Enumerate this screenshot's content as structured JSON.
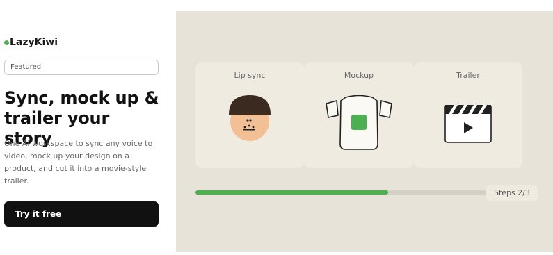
{
  "brand": {
    "name": "LazyKiwi",
    "dot_color": "#4caf50"
  },
  "hero": {
    "badge": "Featured",
    "headline": "Sync, mock up & trailer your story",
    "description": "One AI workspace to sync any voice to video, mock up your design on a product, and cut it into a movie-style trailer.",
    "cta_label": "Try it free"
  },
  "demo": {
    "cards": [
      {
        "label": "Lip sync",
        "icon": "face-icon"
      },
      {
        "label": "Mockup",
        "icon": "tshirt-icon"
      },
      {
        "label": "Trailer",
        "icon": "clapperboard-icon"
      }
    ],
    "progress": {
      "value": 0.66,
      "color": "#4caf50"
    },
    "steps_label": "Steps 2/3"
  }
}
